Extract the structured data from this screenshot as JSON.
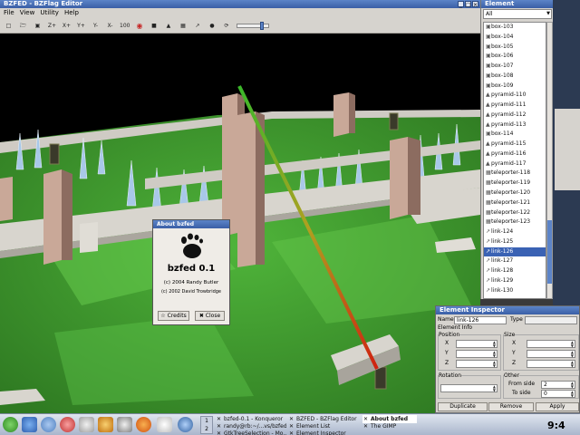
{
  "main_window": {
    "title": "BZFED - BZFlag Editor",
    "menu": [
      "File",
      "View",
      "Utility",
      "Help"
    ],
    "toolbar": {
      "x_plus": "X+",
      "y_plus": "Y+",
      "y_minus": "Y-",
      "x_minus": "X-",
      "zoom_label": "100",
      "zoom_level": 0.78
    }
  },
  "about": {
    "title": "About bzfed",
    "name": "bzfed 0.1",
    "copyright1": "(c) 2004 Randy Butler",
    "copyright2": "(c) 2002 David Trowbridge",
    "credits_label": "Credits",
    "close_label": "Close"
  },
  "element_list": {
    "title": "Element",
    "filter": "All",
    "items": [
      {
        "label": "box-103",
        "icon": "box-icon"
      },
      {
        "label": "box-104",
        "icon": "box-icon"
      },
      {
        "label": "box-105",
        "icon": "box-icon"
      },
      {
        "label": "box-106",
        "icon": "box-icon"
      },
      {
        "label": "box-107",
        "icon": "box-icon"
      },
      {
        "label": "box-108",
        "icon": "box-icon"
      },
      {
        "label": "box-109",
        "icon": "box-icon"
      },
      {
        "label": "pyramid-110",
        "icon": "pyramid-icon"
      },
      {
        "label": "pyramid-111",
        "icon": "pyramid-icon"
      },
      {
        "label": "pyramid-112",
        "icon": "pyramid-icon"
      },
      {
        "label": "pyramid-113",
        "icon": "pyramid-icon"
      },
      {
        "label": "box-114",
        "icon": "box-icon"
      },
      {
        "label": "pyramid-115",
        "icon": "pyramid-icon"
      },
      {
        "label": "pyramid-116",
        "icon": "pyramid-icon"
      },
      {
        "label": "pyramid-117",
        "icon": "pyramid-icon"
      },
      {
        "label": "teleporter-118",
        "icon": "teleporter-icon"
      },
      {
        "label": "teleporter-119",
        "icon": "teleporter-icon"
      },
      {
        "label": "teleporter-120",
        "icon": "teleporter-icon"
      },
      {
        "label": "teleporter-121",
        "icon": "teleporter-icon"
      },
      {
        "label": "teleporter-122",
        "icon": "teleporter-icon"
      },
      {
        "label": "teleporter-123",
        "icon": "teleporter-icon"
      },
      {
        "label": "link-124",
        "icon": "link-icon"
      },
      {
        "label": "link-125",
        "icon": "link-icon"
      },
      {
        "label": "link-126",
        "icon": "link-icon",
        "selected": true
      },
      {
        "label": "link-127",
        "icon": "link-icon"
      },
      {
        "label": "link-128",
        "icon": "link-icon"
      },
      {
        "label": "link-129",
        "icon": "link-icon"
      },
      {
        "label": "link-130",
        "icon": "link-icon"
      }
    ]
  },
  "inspector": {
    "title": "Element Inspector",
    "name_label": "Name",
    "name_value": "link-126",
    "type_label": "Type",
    "type_value": "",
    "info_label": "Element Info",
    "position_label": "Position",
    "size_label": "Size",
    "x_label": "X",
    "y_label": "Y",
    "z_label": "Z",
    "rotation_label": "Rotation",
    "other_label": "Other",
    "from_side_label": "From side",
    "from_side_value": "2",
    "to_side_label": "To side",
    "to_side_value": "0",
    "duplicate_label": "Duplicate",
    "remove_label": "Remove",
    "apply_label": "Apply"
  },
  "taskbar": {
    "tasks": [
      {
        "label": "bzfed-0.1 - Konqueror",
        "active": false
      },
      {
        "label": "randy@rb:~/...vs/bzfed/",
        "active": false
      },
      {
        "label": "GtkTreeSelection - Mo...",
        "active": false
      },
      {
        "label": "BZFED - BZFlag Editor",
        "active": false
      },
      {
        "label": "Element List",
        "active": false
      },
      {
        "label": "Element Inspector",
        "active": false
      },
      {
        "label": "About bzfed",
        "active": true
      },
      {
        "label": "The GIMP",
        "active": false
      }
    ],
    "clock": "9:4"
  },
  "colors": {
    "titlebar": "#3a5fa6",
    "selection": "#3a62b4",
    "ground": "#3c8a2a",
    "sky": "#000000",
    "wall": "#cfcbc4",
    "box": "#b89a8c",
    "spike": "#a8c8e8"
  }
}
